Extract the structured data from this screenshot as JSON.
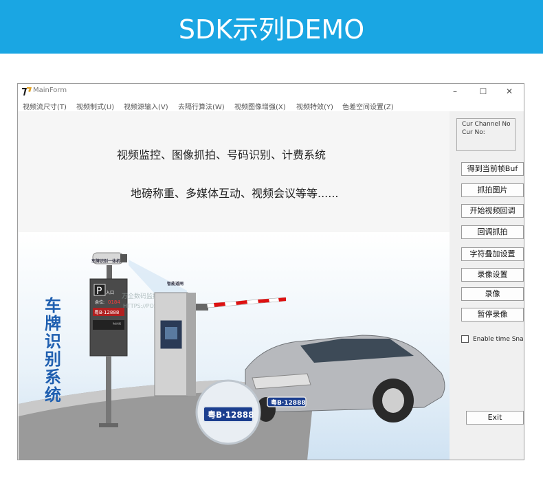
{
  "banner": {
    "title": "SDK示列DEMO"
  },
  "window": {
    "title": "MainForm",
    "controls": {
      "minimize": "–",
      "maximize": "☐",
      "close": "✕"
    },
    "menu": [
      "视频流尺寸(T)",
      "视频制式(U)",
      "视频源输入(V)",
      "去隔行算法(W)",
      "视频图像增强(X)",
      "视频特效(Y)",
      "色差空间设置(Z)"
    ]
  },
  "canvas": {
    "line1": "视频监控、图像抓拍、号码识别、计费系统",
    "line2": "地磅称重、多媒体互动、视频会议等等......",
    "side_text": "车牌识别系统",
    "label_camera": "车牌识别一体机",
    "label_gate": "智能道闸",
    "sign_p": "P",
    "sign_entry": "入口",
    "sign_remaining": "余位:",
    "sign_count": "0184",
    "sign_plate": "粤B·12888",
    "sign_small": "欢迎光临",
    "watermark": "万全数码监控",
    "watermark_url": "HTTPS://POS",
    "plate_car": "粤B·12888",
    "plate_zoom": "粤B·12888"
  },
  "panel": {
    "group_line1": "Cur Channel No",
    "group_line2": "Cur No:",
    "buttons": [
      "得到当前帧Buf",
      "抓拍图片",
      "开始视频回调",
      "回调抓拍",
      "字符叠加设置",
      "录像设置",
      "录像",
      "暂停录像"
    ],
    "checkbox_label": "Enable time Snap",
    "exit_button": "Exit"
  },
  "colors": {
    "banner": "#1aa6e3",
    "plate_blue": "#1c3f8f",
    "side_text": "#1f5fb0"
  }
}
